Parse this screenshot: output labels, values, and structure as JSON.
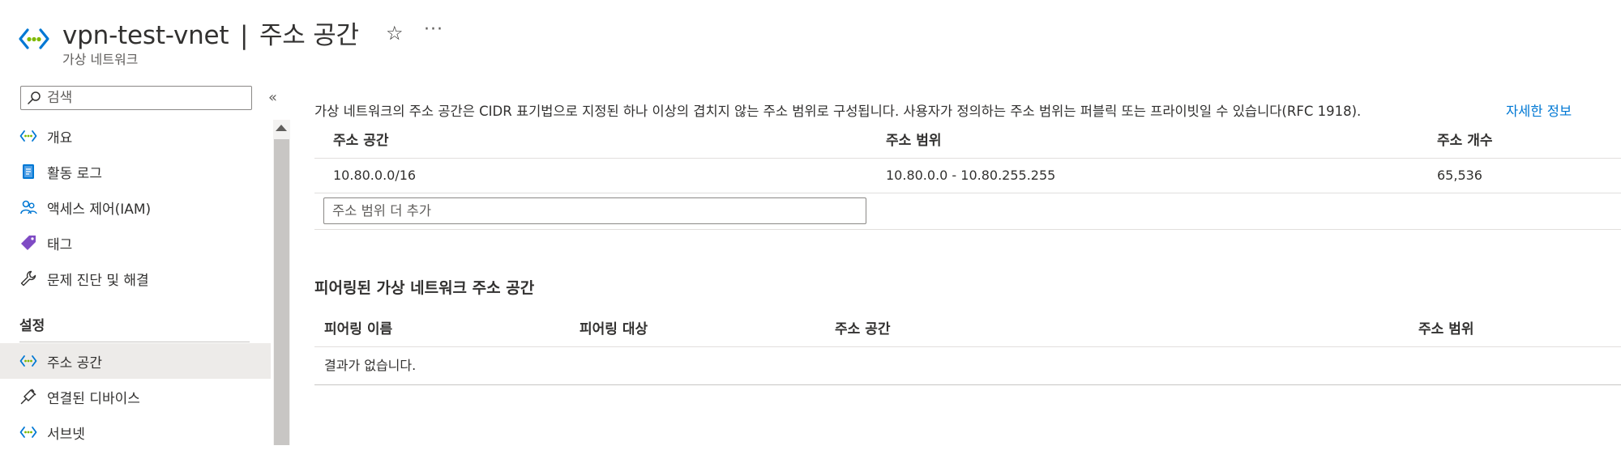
{
  "header": {
    "resource_name": "vpn-test-vnet",
    "separator": "|",
    "page_name": "주소 공간",
    "subtitle": "가상 네트워크",
    "favorite_icon": "☆",
    "more_icon": "···",
    "icon": "vnet-icon"
  },
  "sidebar": {
    "search_placeholder": "검색",
    "collapse_label": "«",
    "items_top": [
      {
        "label": "개요",
        "icon": "vnet-icon"
      },
      {
        "label": "활동 로그",
        "icon": "activity-log-icon"
      },
      {
        "label": "액세스 제어(IAM)",
        "icon": "iam-icon"
      },
      {
        "label": "태그",
        "icon": "tag-icon"
      },
      {
        "label": "문제 진단 및 해결",
        "icon": "wrench-icon"
      }
    ],
    "section_settings": "설정",
    "items_settings": [
      {
        "label": "주소 공간",
        "icon": "vnet-icon",
        "active": true
      },
      {
        "label": "연결된 디바이스",
        "icon": "plug-icon"
      },
      {
        "label": "서브넷",
        "icon": "vnet-icon"
      }
    ]
  },
  "main": {
    "intro_text": "가상 네트워크의 주소 공간은 CIDR 표기법으로 지정된 하나 이상의 겹치지 않는 주소 범위로 구성됩니다. 사용자가 정의하는 주소 범위는 퍼블릭 또는 프라이빗일 수 있습니다(RFC 1918).",
    "learn_more": "자세한 정보",
    "address_table": {
      "columns": [
        "주소 공간",
        "주소 범위",
        "주소 개수"
      ],
      "rows": [
        [
          "10.80.0.0/16",
          "10.80.0.0 - 10.80.255.255",
          "65,536"
        ]
      ],
      "add_placeholder": "주소 범위 더 추가"
    },
    "peered": {
      "title": "피어링된 가상 네트워크 주소 공간",
      "columns": [
        "피어링 이름",
        "피어링 대상",
        "주소 공간",
        "주소 범위"
      ],
      "empty_text": "결과가 없습니다."
    }
  },
  "colors": {
    "accent": "#0078d4",
    "active_bg": "#edebe9",
    "text": "#323130"
  }
}
